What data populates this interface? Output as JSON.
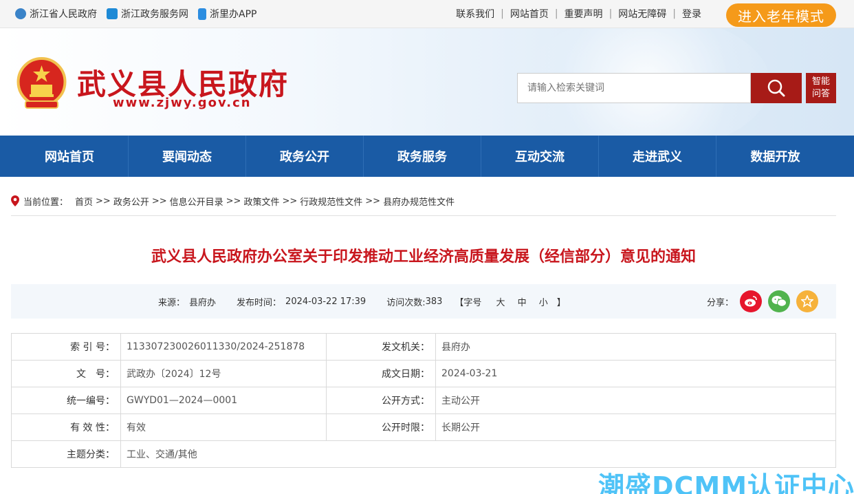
{
  "topbar": {
    "links": [
      {
        "label": "浙江省人民政府"
      },
      {
        "label": "浙江政务服务网"
      },
      {
        "label": "浙里办APP"
      }
    ],
    "right_links": [
      "联系我们",
      "网站首页",
      "重要声明",
      "网站无障碍",
      "登录"
    ],
    "separator": "|",
    "elder_mode": "进入老年模式"
  },
  "header": {
    "site_name": "武义县人民政府",
    "site_url": "www.zjwy.gov.cn",
    "search_placeholder": "请输入检索关键词",
    "ai_line1": "智能",
    "ai_line2": "问答"
  },
  "nav": [
    "网站首页",
    "要闻动态",
    "政务公开",
    "政务服务",
    "互动交流",
    "走进武义",
    "数据开放"
  ],
  "breadcrumb": {
    "label": "当前位置：",
    "items": [
      "首页",
      "政务公开",
      "信息公开目录",
      "政策文件",
      "行政规范性文件",
      "县府办规范性文件"
    ],
    "separator": ">>"
  },
  "document": {
    "title": "武义县人民政府办公室关于印发推动工业经济高质量发展（经信部分）意见的通知",
    "source_label": "来源：",
    "source": "县府办",
    "published_label": "发布时间：",
    "published": "2024-03-22 17:39",
    "visits_label": "访问次数:",
    "visits": "383",
    "font_open": "【字号",
    "font_large": "大",
    "font_medium": "中",
    "font_small": "小",
    "font_close": "】",
    "share_label": "分享："
  },
  "info_table": {
    "rows": [
      {
        "l1": "索 引 号：",
        "v1": "113307230026011330/2024-251878",
        "l2": "发文机关：",
        "v2": "县府办"
      },
      {
        "l1": "文　号：",
        "v1": "武政办〔2024〕12号",
        "l2": "成文日期：",
        "v2": "2024-03-21"
      },
      {
        "l1": "统一编号：",
        "v1": "GWYD01—2024—0001",
        "l2": "公开方式：",
        "v2": "主动公开"
      },
      {
        "l1": "有 效 性：",
        "v1": "有效",
        "l2": "公开时限：",
        "v2": "长期公开"
      }
    ],
    "subject_label": "主题分类：",
    "subject_value": "工业、交通/其他"
  },
  "watermark": "潮盛DCMM认证中心",
  "colors": {
    "brand_red": "#c8161d",
    "nav_blue": "#1a5ba5",
    "elder_orange": "#f59a1a",
    "search_red": "#a71b17"
  }
}
